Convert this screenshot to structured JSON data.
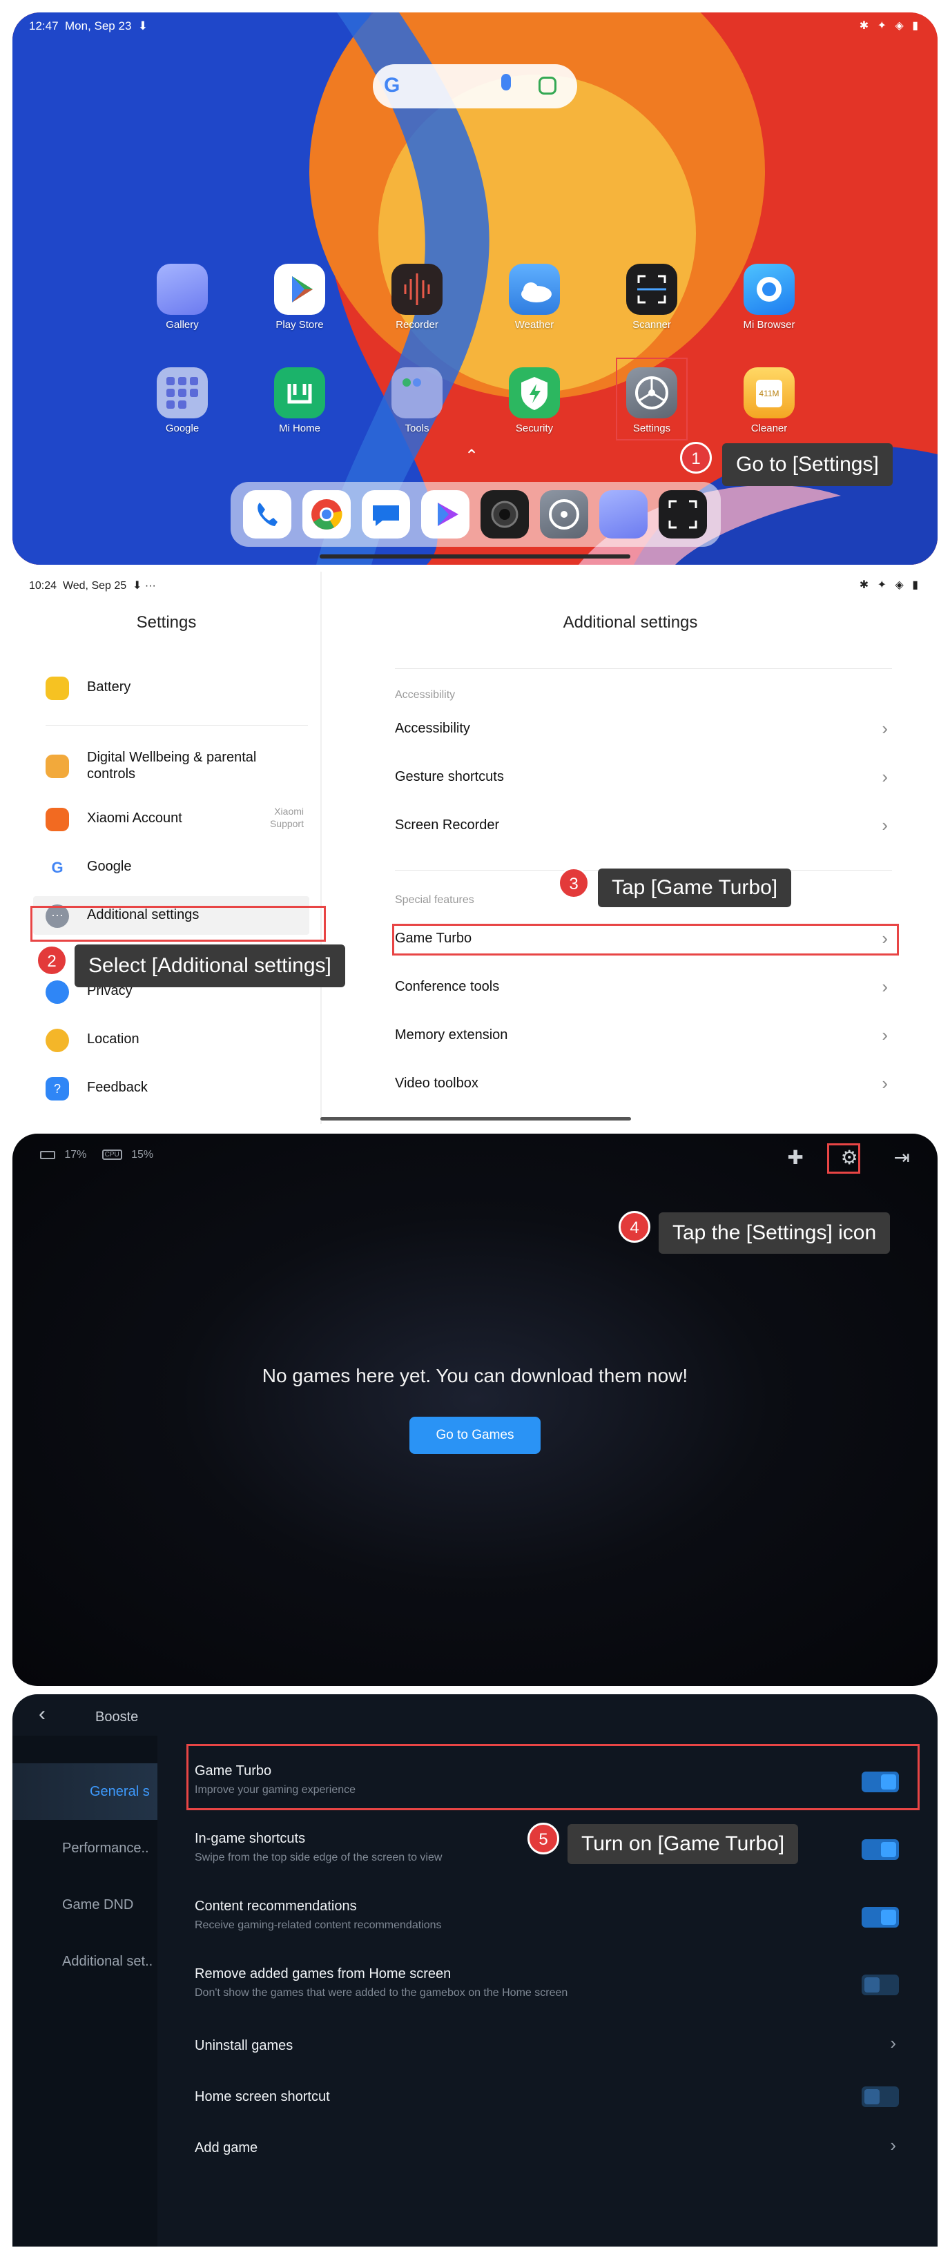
{
  "panel1": {
    "status_time": "12:47",
    "status_date": "Mon, Sep 23",
    "status_icons": "✱ ✦ ◈ ▮",
    "apps_row1": [
      "Gallery",
      "Play Store",
      "Recorder",
      "Weather",
      "Scanner",
      "Mi Browser"
    ],
    "apps_row2": [
      "Google",
      "Mi Home",
      "Tools",
      "Security",
      "Settings",
      "Cleaner"
    ],
    "cleaner_badge": "411M",
    "dock_icons": [
      "phone-icon",
      "chrome-icon",
      "messages-icon",
      "play-games-icon",
      "camera-icon",
      "settings-icon",
      "gallery-icon",
      "scanner-icon"
    ],
    "step_number": "1",
    "step_text": "Go to [Settings]"
  },
  "panel2": {
    "status_time": "10:24",
    "status_date": "Wed, Sep 25",
    "status_extra": "⬇ ···",
    "left_title": "Settings",
    "left_items": [
      {
        "label": "Battery",
        "sub": ""
      },
      {
        "label": "Digital Wellbeing & parental controls",
        "sub": ""
      },
      {
        "label": "Xiaomi Account",
        "sub": "Xiaomi Support"
      },
      {
        "label": "Google",
        "sub": ""
      },
      {
        "label": "Additional settings",
        "sub": ""
      },
      {
        "label": "Privacy",
        "sub": ""
      },
      {
        "label": "Location",
        "sub": ""
      },
      {
        "label": "Feedback",
        "sub": ""
      }
    ],
    "right_title": "Additional settings",
    "section_accessibility": "Accessibility",
    "section_special": "Special features",
    "right_items": [
      "Accessibility",
      "Gesture shortcuts",
      "Screen Recorder",
      "Game Turbo",
      "Conference tools",
      "Memory extension",
      "Video toolbox"
    ],
    "step2_number": "2",
    "step2_text": "Select [Additional settings]",
    "step3_number": "3",
    "step3_text": "Tap [Game Turbo]"
  },
  "panel3": {
    "battery": "17%",
    "cpu_label": "CPU",
    "cpu": "15%",
    "empty_message": "No games here yet. You can download them now!",
    "go_button": "Go to Games",
    "step_number": "4",
    "step_text": "Tap the [Settings] icon"
  },
  "panel4": {
    "header_title": "Booste",
    "nav": [
      "General s",
      "Performance..",
      "Game DND",
      "Additional set.."
    ],
    "rows": [
      {
        "title": "Game Turbo",
        "sub": "Improve your gaming experience",
        "control": "toggle",
        "on": true
      },
      {
        "title": "In-game shortcuts",
        "sub": "Swipe from the top side edge of the screen to view",
        "control": "toggle",
        "on": true
      },
      {
        "title": "Content recommendations",
        "sub": "Receive gaming-related content recommendations",
        "control": "toggle",
        "on": true
      },
      {
        "title": "Remove added games from Home screen",
        "sub": "Don't show the games that were added to the gamebox on the Home screen",
        "control": "toggle",
        "on": false
      },
      {
        "title": "Uninstall games",
        "sub": "",
        "control": "chevron",
        "on": false
      },
      {
        "title": "Home screen shortcut",
        "sub": "",
        "control": "toggle",
        "on": false
      },
      {
        "title": "Add game",
        "sub": "",
        "control": "chevron",
        "on": false
      }
    ],
    "step_number": "5",
    "step_text": "Turn on [Game Turbo]"
  },
  "colors": {
    "callout_bg": "#3a3a3a",
    "badge": "#e33a3a",
    "highlight": "#e84545",
    "accent_blue": "#2a93f5"
  }
}
